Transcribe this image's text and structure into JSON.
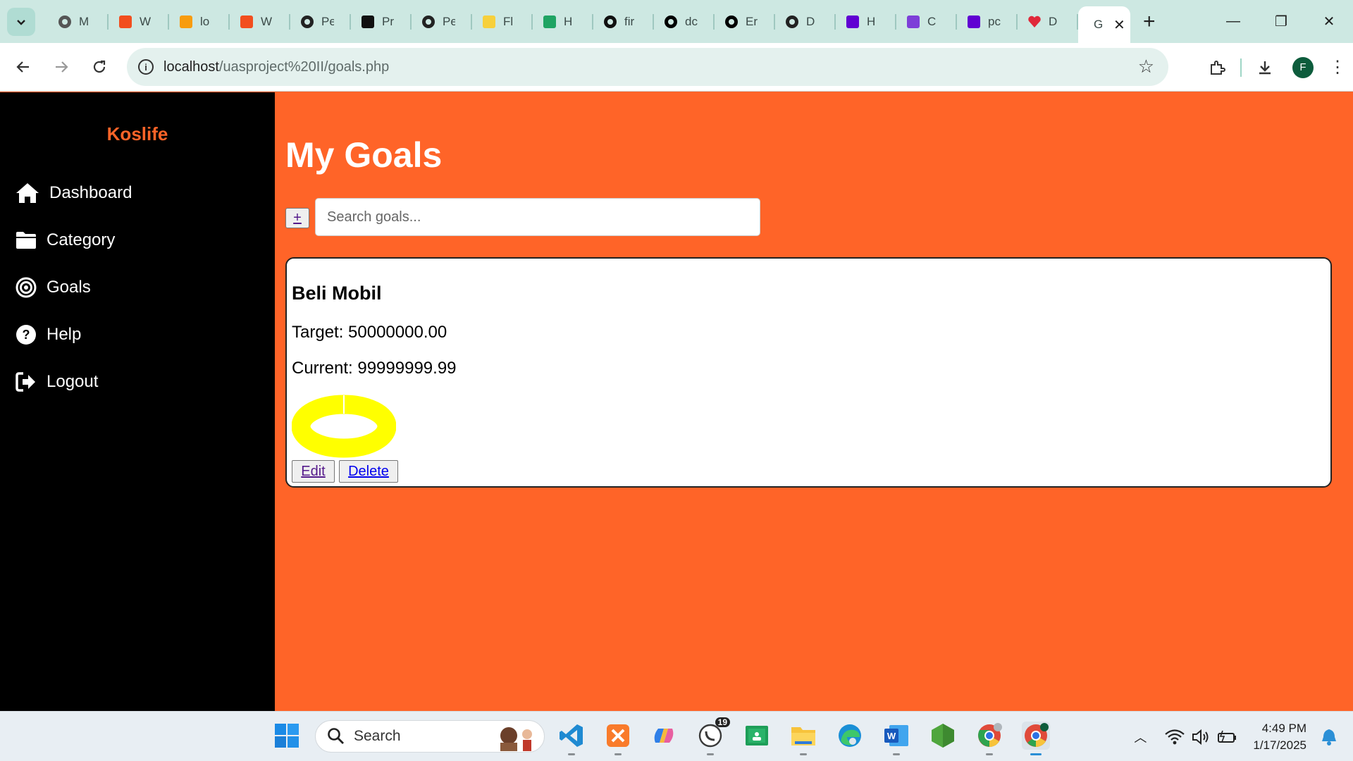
{
  "browser": {
    "tabs": [
      {
        "title": "M",
        "icon": "globe-icon"
      },
      {
        "title": "W",
        "icon": "figma-icon"
      },
      {
        "title": "lo",
        "icon": "phpmyadmin-icon"
      },
      {
        "title": "W",
        "icon": "figma-icon"
      },
      {
        "title": "Pe",
        "icon": "openai-icon"
      },
      {
        "title": "Pr",
        "icon": "notion-icon"
      },
      {
        "title": "Pe",
        "icon": "codepen-icon"
      },
      {
        "title": "Fl",
        "icon": "miro-icon"
      },
      {
        "title": "H",
        "icon": "google-drive-icon"
      },
      {
        "title": "fir",
        "icon": "github-icon"
      },
      {
        "title": "dc",
        "icon": "vercel-icon"
      },
      {
        "title": "Er",
        "icon": "vercel-icon"
      },
      {
        "title": "D",
        "icon": "codepen-icon"
      },
      {
        "title": "H",
        "icon": "yahoo-icon"
      },
      {
        "title": "C",
        "icon": "canva-icon"
      },
      {
        "title": "pc",
        "icon": "yahoo-icon"
      },
      {
        "title": "D",
        "icon": "heart-icon"
      }
    ],
    "active_tab": {
      "title": "G"
    },
    "url_host": "localhost",
    "url_path": "/uasproject%20II/goals.php",
    "profile_initial": "F"
  },
  "app": {
    "brand": "Koslife",
    "nav": [
      {
        "label": "Dashboard",
        "icon": "home-icon"
      },
      {
        "label": "Category",
        "icon": "folder-icon"
      },
      {
        "label": "Goals",
        "icon": "target-icon"
      },
      {
        "label": "Help",
        "icon": "help-icon"
      },
      {
        "label": "Logout",
        "icon": "logout-icon"
      }
    ],
    "title": "My Goals",
    "add_label": "+",
    "search_placeholder": "Search goals...",
    "goals": [
      {
        "name": "Beli Mobil",
        "target_text": "Target: 50000000.00",
        "current_text": "Current: 99999999.99",
        "target": 50000000.0,
        "current": 99999999.99,
        "progress_color": "#ffff00",
        "edit_label": "Edit",
        "delete_label": "Delete"
      }
    ]
  },
  "colors": {
    "page_bg": "#ff6428",
    "sidebar_bg": "#000000",
    "brand": "#ff6428"
  },
  "taskbar": {
    "search_label": "Search",
    "whatsapp_badge": "19",
    "time": "4:49 PM",
    "date": "1/17/2025"
  }
}
